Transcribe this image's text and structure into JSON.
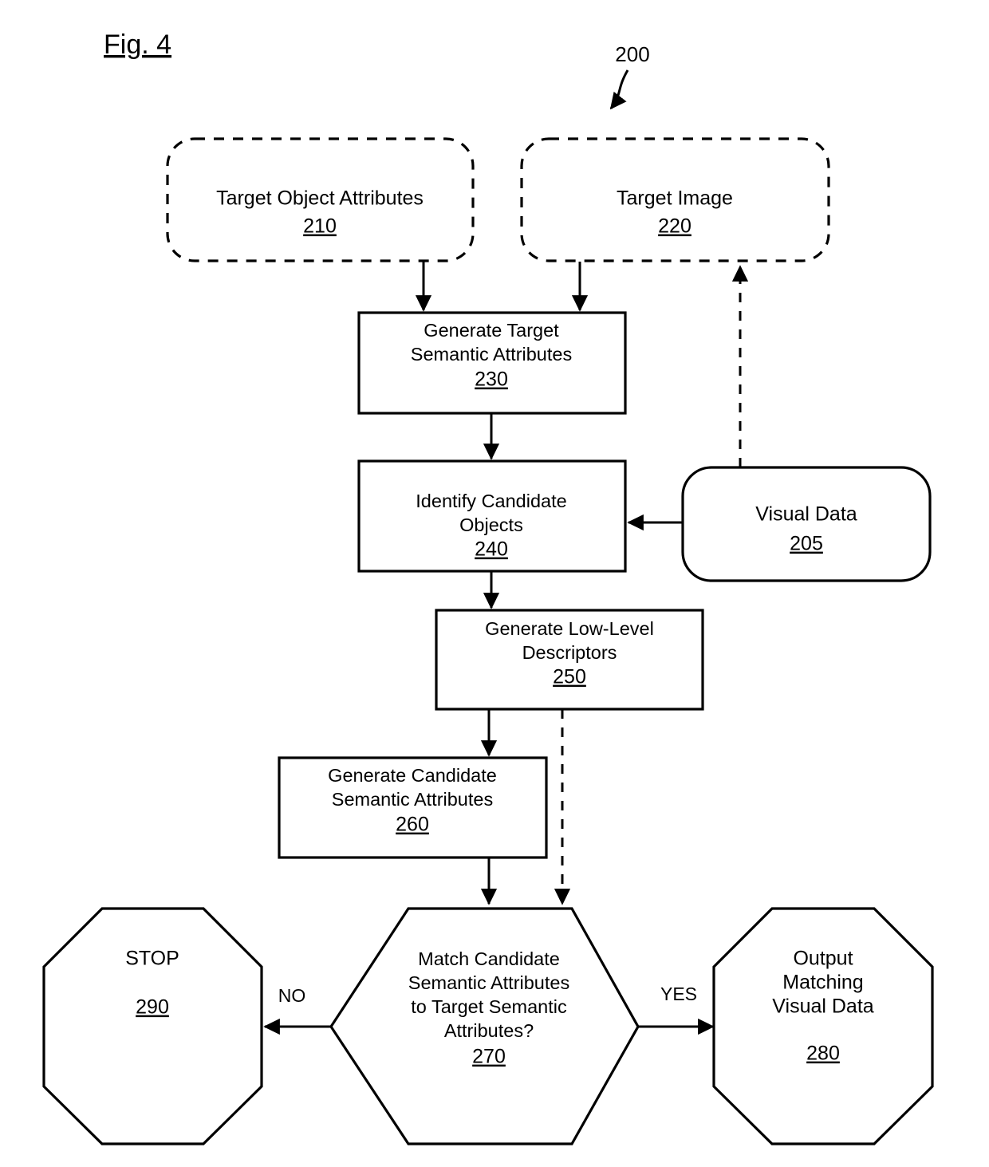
{
  "figure": {
    "label": "Fig. 4",
    "diagram_reference": "200"
  },
  "nodes": {
    "target_object_attributes": {
      "line1": "Target Object Attributes",
      "ref": "210",
      "shape": "dashed-rounded-rect"
    },
    "target_image": {
      "line1": "Target Image",
      "ref": "220",
      "shape": "dashed-rounded-rect"
    },
    "generate_target_semantic_attributes": {
      "line1": "Generate Target",
      "line2": "Semantic Attributes",
      "ref": "230",
      "shape": "rect"
    },
    "identify_candidate_objects": {
      "line1": "Identify Candidate",
      "line2": "Objects",
      "ref": "240",
      "shape": "rect"
    },
    "visual_data": {
      "line1": "Visual Data",
      "ref": "205",
      "shape": "rounded-rect"
    },
    "generate_low_level_descriptors": {
      "line1": "Generate Low-Level",
      "line2": "Descriptors",
      "ref": "250",
      "shape": "rect"
    },
    "generate_candidate_semantic_attributes": {
      "line1": "Generate Candidate",
      "line2": "Semantic Attributes",
      "ref": "260",
      "shape": "rect"
    },
    "match_decision": {
      "line1": "Match Candidate",
      "line2": "Semantic Attributes",
      "line3": "to Target Semantic",
      "line4": "Attributes?",
      "ref": "270",
      "shape": "hexagon"
    },
    "stop": {
      "line1": "STOP",
      "ref": "290",
      "shape": "octagon"
    },
    "output_matching_visual_data": {
      "line1": "Output",
      "line2": "Matching",
      "line3": "Visual Data",
      "ref": "280",
      "shape": "octagon"
    }
  },
  "edges": {
    "no_branch": "NO",
    "yes_branch": "YES"
  },
  "colors": {
    "stroke": "#000000",
    "fill": "#ffffff",
    "text": "#000000"
  }
}
